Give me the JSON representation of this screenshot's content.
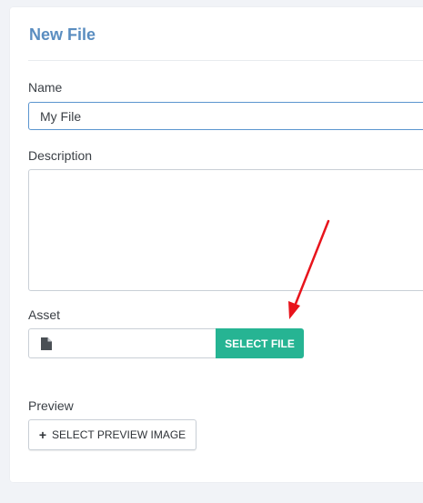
{
  "form": {
    "title": "New File",
    "name_label": "Name",
    "name_value": "My File",
    "description_label": "Description",
    "description_value": "",
    "asset_label": "Asset",
    "select_file_label": "SELECT FILE",
    "preview_label": "Preview",
    "select_preview_label": "SELECT PREVIEW IMAGE"
  },
  "icons": {
    "file": "file-icon",
    "plus": "plus-icon"
  },
  "colors": {
    "title": "#5a8dc0",
    "select_file_button": "#26b493",
    "annotation_arrow": "#e8141c"
  }
}
